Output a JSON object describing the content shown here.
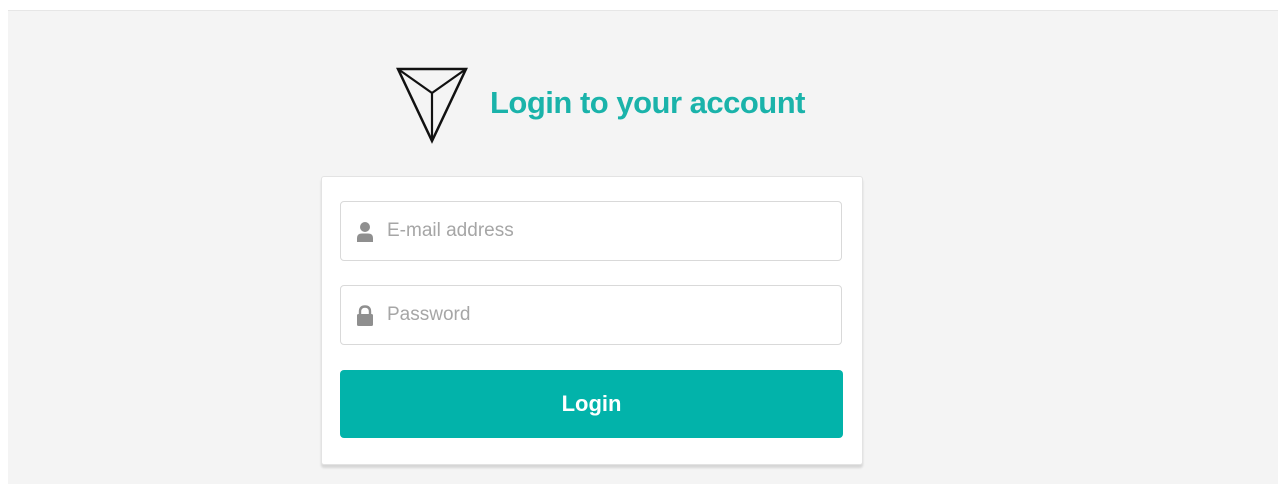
{
  "header": {
    "title": "Login to your account",
    "logo_icon": "triangle-logo-icon"
  },
  "form": {
    "email": {
      "placeholder": "E-mail address",
      "value": "",
      "icon": "user-icon"
    },
    "password": {
      "placeholder": "Password",
      "value": "",
      "icon": "lock-icon"
    },
    "submit_label": "Login"
  },
  "colors": {
    "accent": "#02b3aa",
    "title": "#1ab3aa",
    "background": "#f4f4f4",
    "card": "#ffffff",
    "placeholder": "#a6a6a6",
    "icon": "#8f8f8f"
  }
}
